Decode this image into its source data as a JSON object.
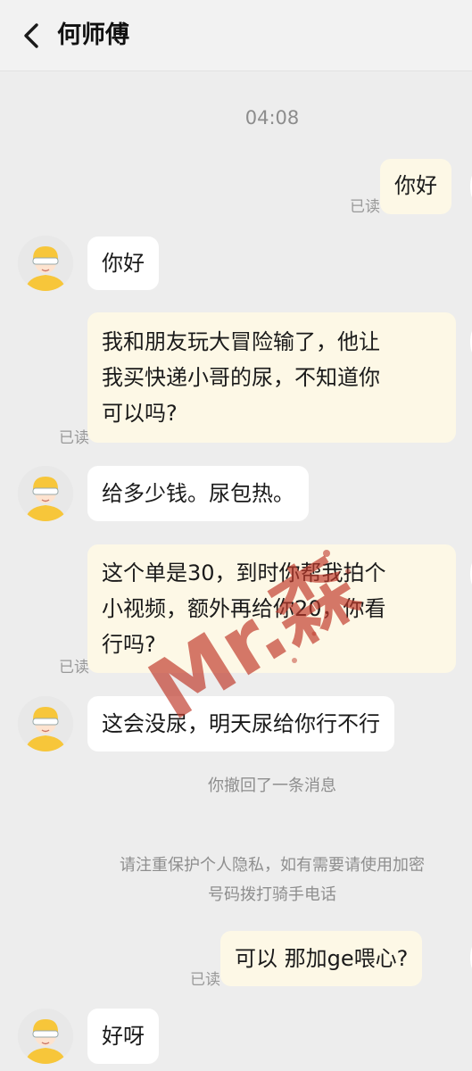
{
  "header": {
    "title": "何师傅"
  },
  "chat": {
    "timestamp": "04:08",
    "read_label": "已读",
    "messages": {
      "out1": "你好",
      "in1": "你好",
      "out2": [
        "我和朋友玩大冒险输了，他让",
        "我买快递小哥的尿，不知道你",
        "可以吗?"
      ],
      "in2": "给多少钱。尿包热。",
      "out3": [
        "这个单是30，到时你帮我拍个",
        "小视频，额外再给你20，你看",
        "行吗?"
      ],
      "in3": "这会没尿，明天尿给你行不行",
      "out4": "可以 那加ge喂心?",
      "in4": "好呀"
    },
    "system": {
      "recalled": "你撤回了一条消息",
      "privacy": [
        "请注重保护个人隐私，如有需要请使用加密",
        "号码拨打骑手电话"
      ]
    }
  },
  "watermark": {
    "text": "Mr.森",
    "color": "#c0392b"
  },
  "icons": {
    "back": "chevron-left-icon",
    "avatar": "courier-avatar-icon"
  }
}
